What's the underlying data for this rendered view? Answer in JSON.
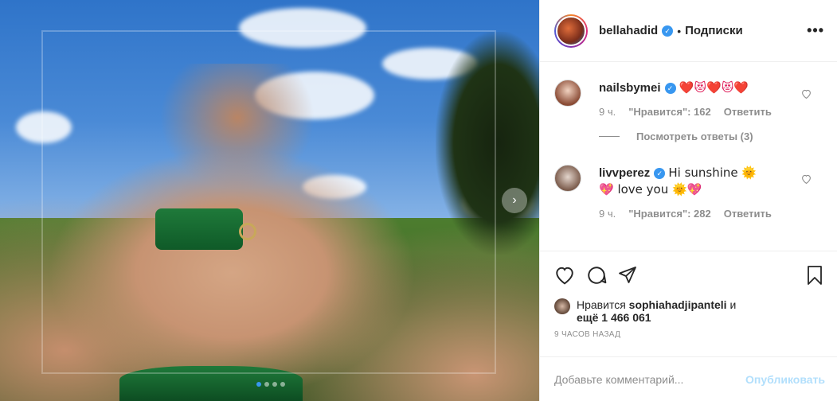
{
  "post": {
    "username": "bellahadid",
    "follow_label": "Подписки",
    "bullet": "•",
    "more_label": "•••",
    "photo_alt": "photo",
    "next_arrow": "›"
  },
  "comments": [
    {
      "username": "nailsbymei",
      "text": "❤️😻❤️😻❤️",
      "time": "9 ч.",
      "likes": "\"Нравится\": 162",
      "reply_label": "Ответить",
      "verified": true
    },
    {
      "username": "livvperez",
      "text": "Hi sunshine 🌞 💖 love you 🌞💖",
      "time": "9 ч.",
      "likes": "\"Нравится\": 282",
      "reply_label": "Ответить",
      "verified": true
    }
  ],
  "view_replies_label": "Посмотреть ответы (3)",
  "likes": {
    "prefix": "Нравится",
    "liked_by": "sophiahadjipanteli",
    "and": "и",
    "more": "ещё 1 466 061"
  },
  "time_ago": "9 ЧАСОВ НАЗАД",
  "add_comment": {
    "placeholder": "Добавьте комментарий...",
    "publish_label": "Опубликовать"
  },
  "icons": {
    "heart": "heart-icon",
    "comment": "comment-icon",
    "share": "share-icon",
    "save": "bookmark-icon",
    "like_small": "heart-outline-icon"
  },
  "colors": {
    "accent": "#3897f0",
    "publish_disabled": "#b2dffc",
    "meta_text": "#8e8e8e"
  },
  "carousel": {
    "slides": 4,
    "active_index": 0
  }
}
